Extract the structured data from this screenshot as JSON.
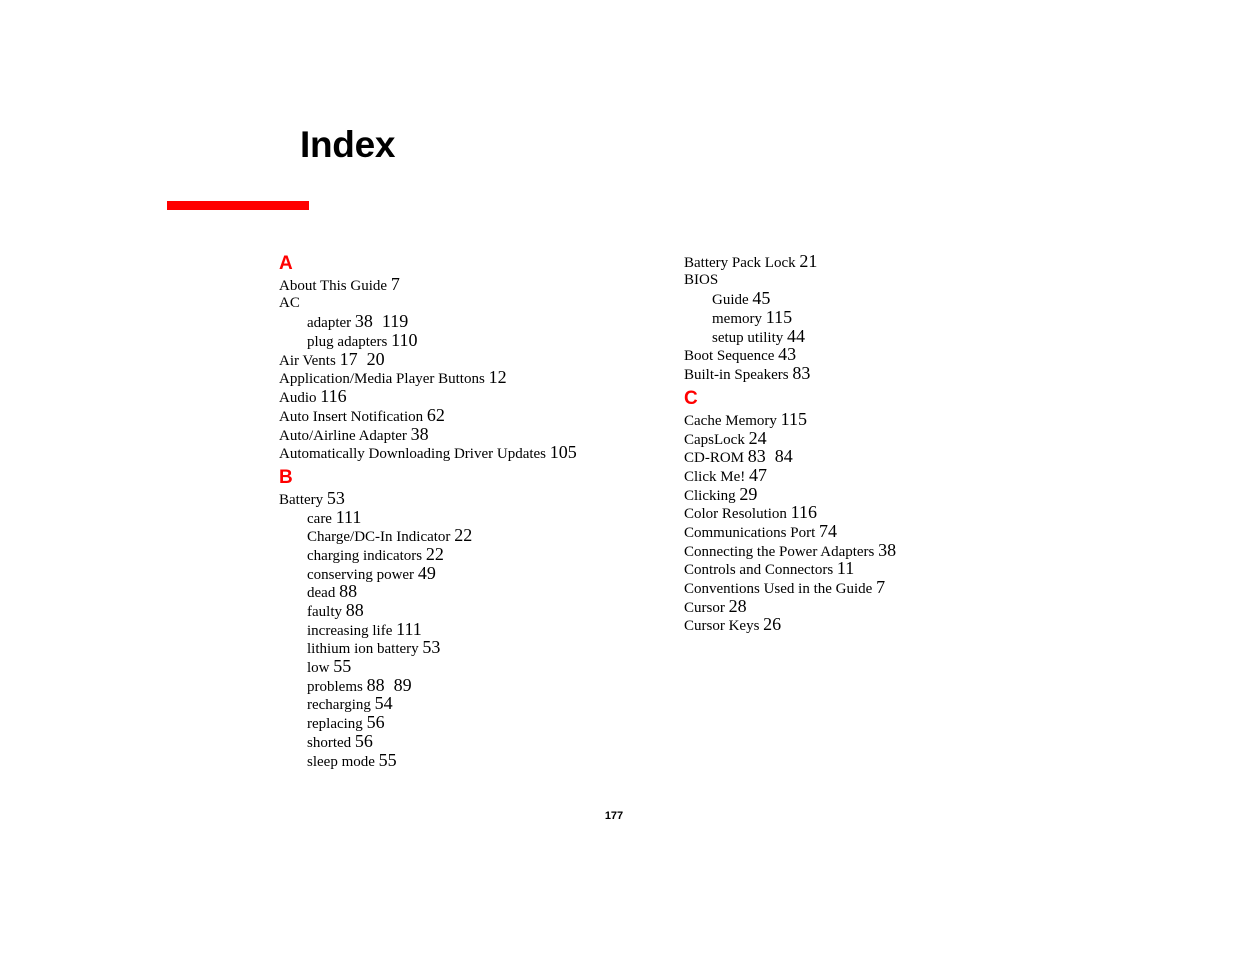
{
  "page": {
    "title": "Index",
    "accent_color": "#ff0000",
    "page_number": "177"
  },
  "left_column": {
    "sections": [
      {
        "letter": "A",
        "entries": [
          {
            "term": "About This Guide",
            "pages": "7",
            "level": 0
          },
          {
            "term": "AC",
            "pages": "",
            "level": 0
          },
          {
            "term": "adapter",
            "pages": "38  119",
            "level": 1
          },
          {
            "term": "plug adapters",
            "pages": "110",
            "level": 1
          },
          {
            "term": "Air Vents",
            "pages": "17  20",
            "level": 0
          },
          {
            "term": "Application/Media Player Buttons",
            "pages": "12",
            "level": 0
          },
          {
            "term": "Audio",
            "pages": "116",
            "level": 0
          },
          {
            "term": "Auto Insert Notification",
            "pages": "62",
            "level": 0
          },
          {
            "term": "Auto/Airline Adapter",
            "pages": "38",
            "level": 0
          },
          {
            "term": "Automatically Downloading Driver Updates",
            "pages": "105",
            "level": 0
          }
        ]
      },
      {
        "letter": "B",
        "entries": [
          {
            "term": "Battery",
            "pages": "53",
            "level": 0
          },
          {
            "term": "care",
            "pages": "111",
            "level": 1
          },
          {
            "term": "Charge/DC-In Indicator",
            "pages": "22",
            "level": 1
          },
          {
            "term": "charging indicators",
            "pages": "22",
            "level": 1
          },
          {
            "term": "conserving power",
            "pages": "49",
            "level": 1
          },
          {
            "term": "dead",
            "pages": "88",
            "level": 1
          },
          {
            "term": "faulty",
            "pages": "88",
            "level": 1
          },
          {
            "term": "increasing life",
            "pages": "111",
            "level": 1
          },
          {
            "term": "lithium ion battery",
            "pages": "53",
            "level": 1
          },
          {
            "term": "low",
            "pages": "55",
            "level": 1
          },
          {
            "term": "problems",
            "pages": "88  89",
            "level": 1
          },
          {
            "term": "recharging",
            "pages": "54",
            "level": 1
          },
          {
            "term": "replacing",
            "pages": "56",
            "level": 1
          },
          {
            "term": "shorted",
            "pages": "56",
            "level": 1
          },
          {
            "term": "sleep mode",
            "pages": "55",
            "level": 1
          }
        ]
      }
    ]
  },
  "right_column": {
    "continued_entries": [
      {
        "term": "Battery Pack Lock",
        "pages": "21",
        "level": 0
      },
      {
        "term": "BIOS",
        "pages": "",
        "level": 0
      },
      {
        "term": "Guide",
        "pages": "45",
        "level": 1
      },
      {
        "term": "memory",
        "pages": "115",
        "level": 1
      },
      {
        "term": "setup utility",
        "pages": "44",
        "level": 1
      },
      {
        "term": "Boot Sequence",
        "pages": "43",
        "level": 0
      },
      {
        "term": "Built-in Speakers",
        "pages": "83",
        "level": 0
      }
    ],
    "sections": [
      {
        "letter": "C",
        "entries": [
          {
            "term": "Cache Memory",
            "pages": "115",
            "level": 0
          },
          {
            "term": "CapsLock",
            "pages": "24",
            "level": 0
          },
          {
            "term": "CD-ROM",
            "pages": "83  84",
            "level": 0
          },
          {
            "term": "Click Me!",
            "pages": "47",
            "level": 0
          },
          {
            "term": "Clicking",
            "pages": "29",
            "level": 0
          },
          {
            "term": "Color Resolution",
            "pages": "116",
            "level": 0
          },
          {
            "term": "Communications Port",
            "pages": "74",
            "level": 0
          },
          {
            "term": "Connecting the Power Adapters",
            "pages": "38",
            "level": 0
          },
          {
            "term": "Controls and Connectors",
            "pages": "11",
            "level": 0
          },
          {
            "term": "Conventions Used in the Guide",
            "pages": "7",
            "level": 0
          },
          {
            "term": "Cursor",
            "pages": "28",
            "level": 0
          },
          {
            "term": "Cursor Keys",
            "pages": "26",
            "level": 0
          }
        ]
      }
    ]
  }
}
